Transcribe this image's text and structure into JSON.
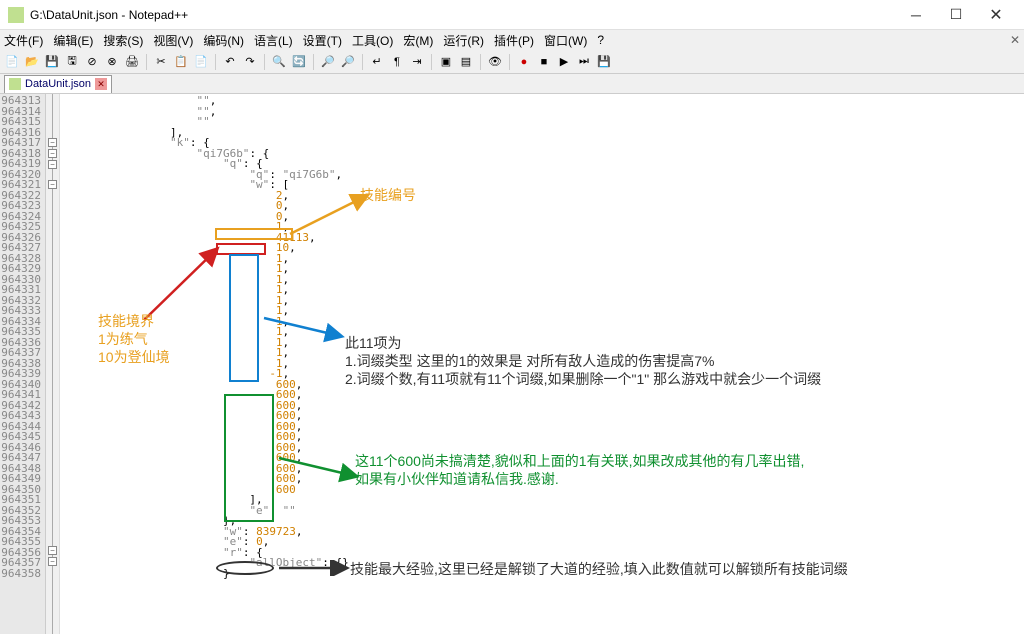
{
  "window": {
    "title": "G:\\DataUnit.json - Notepad++"
  },
  "menu": {
    "items": [
      "文件(F)",
      "编辑(E)",
      "搜索(S)",
      "视图(V)",
      "编码(N)",
      "语言(L)",
      "设置(T)",
      "工具(O)",
      "宏(M)",
      "运行(R)",
      "插件(P)",
      "窗口(W)",
      "?"
    ]
  },
  "tab": {
    "name": "DataUnit.json"
  },
  "gutter": {
    "start": 964313,
    "count": 46
  },
  "code_lines": [
    "                    \"\",",
    "                    \"\",",
    "                    \"\"",
    "                ],",
    "                \"k\": {",
    "                    \"qi7G6b\": {",
    "                        \"q\": {",
    "                            \"q\": \"qi7G6b\",",
    "                            \"w\": [",
    "                                2,",
    "                                0,",
    "                                0,",
    "                                1,",
    "                                41113,",
    "                                10,",
    "                                1,",
    "                                1,",
    "                                1,",
    "                                1,",
    "                                1,",
    "                                1,",
    "                                1,",
    "                                1,",
    "                                1,",
    "                                1,",
    "                                1,",
    "                               -1,",
    "                                600,",
    "                                600,",
    "                                600,",
    "                                600,",
    "                                600,",
    "                                600,",
    "                                600,",
    "                                600,",
    "                                600,",
    "                                600,",
    "                                600",
    "                            ],",
    "                            \"e\": \"\"",
    "                        },",
    "                        \"w\": 839723,",
    "                        \"e\": 0,",
    "                        \"r\": {",
    "                            \"allObject\": {}",
    "                        }"
  ],
  "annotations": {
    "skill_number": {
      "label": "技能编号",
      "color": "#e8a020"
    },
    "skill_level": {
      "line1": "技能境界",
      "line2": "1为练气",
      "line3": "10为登仙境",
      "color": "#e8a020"
    },
    "eleven_items": {
      "line1": "此11项为",
      "line2": "1.词缀类型 这里的1的效果是 对所有敌人造成的伤害提高7%",
      "line3": "2.词缀个数,有11项就有11个词缀,如果删除一个\"1\" 那么游戏中就会少一个词缀",
      "color": "#1080d0"
    },
    "eleven_600": {
      "line1": "这11个600尚未搞清楚,貌似和上面的1有关联,如果改成其他的有几率出错,",
      "line2": "如果有小伙伴知道请私信我.感谢.",
      "color": "#109030"
    },
    "max_exp": {
      "label": "技能最大经验,这里已经是解锁了大道的经验,填入此数值就可以解锁所有技能词缀",
      "color": "#333"
    }
  }
}
